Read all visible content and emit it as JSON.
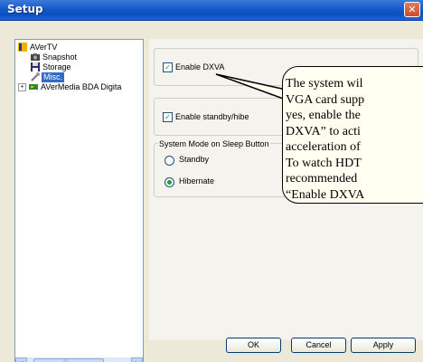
{
  "window": {
    "title": "Setup",
    "close_glyph": "✕"
  },
  "tree": {
    "items": [
      {
        "label": "AVerTV",
        "icon": "avertv-icon"
      },
      {
        "label": "Snapshot",
        "icon": "camera-icon"
      },
      {
        "label": "Storage",
        "icon": "floppy-disk-icon"
      },
      {
        "label": "Misc.",
        "icon": "wrench-icon",
        "selected": true
      },
      {
        "label": "AVerMedia BDA Digita",
        "icon": "tuner-card-icon",
        "expander": "+"
      }
    ],
    "scroll_left": "<",
    "scroll_right": ">",
    "scroll_grip": "|||"
  },
  "settings": {
    "enable_dxva": {
      "label": "Enable DXVA",
      "checked": true
    },
    "enable_standby": {
      "label": "Enable standby/hibe",
      "checked": true
    },
    "sleep_group": {
      "title": "System Mode on Sleep Button",
      "options": [
        "Standby",
        "Hibernate"
      ],
      "selected": "Hibernate"
    }
  },
  "buttons": {
    "ok": "OK",
    "cancel": "Cancel",
    "apply": "Apply"
  },
  "callout": {
    "lines": [
      "The system wil",
      "VGA card supp",
      "yes, enable the",
      "DXVA” to acti",
      "acceleration of",
      "To watch HDT",
      "recommended",
      "“Enable DXVA"
    ]
  },
  "colors": {
    "titlebar": "#0a4fc4",
    "face": "#ece9d8",
    "selection": "#316ac5",
    "check": "#21a121",
    "callout_bg": "#fffff2"
  }
}
